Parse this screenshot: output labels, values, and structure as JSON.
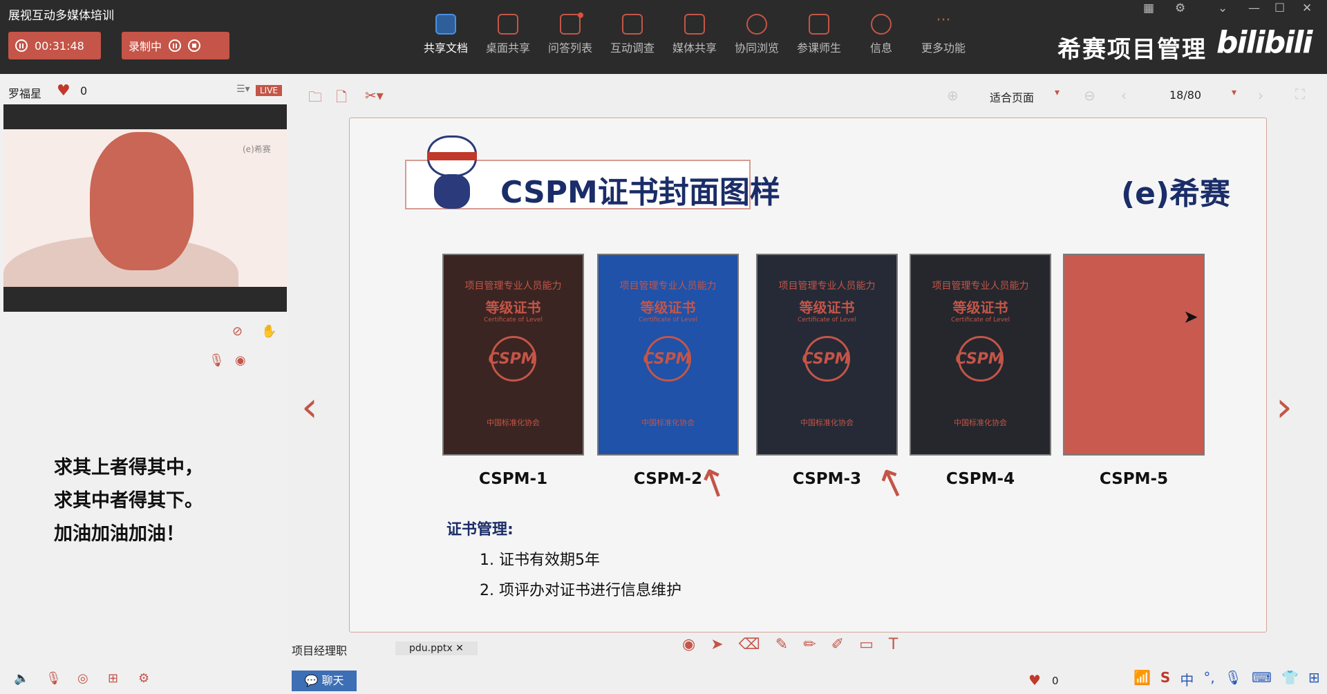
{
  "app": {
    "title": "展视互动多媒体培训"
  },
  "recording": {
    "timer": "00:31:48",
    "status": "录制中"
  },
  "toolbar": [
    {
      "label": "共享文档",
      "icon": "document-icon",
      "active": true
    },
    {
      "label": "桌面共享",
      "icon": "desktop-icon"
    },
    {
      "label": "问答列表",
      "icon": "chat-icon"
    },
    {
      "label": "互动调查",
      "icon": "bar-chart-icon"
    },
    {
      "label": "媒体共享",
      "icon": "film-icon"
    },
    {
      "label": "协同浏览",
      "icon": "compass-icon"
    },
    {
      "label": "参课师生",
      "icon": "users-icon"
    },
    {
      "label": "信息",
      "icon": "info-icon"
    },
    {
      "label": "更多功能",
      "icon": "more-icon"
    }
  ],
  "brand": {
    "text": "希赛项目管理",
    "logo": "bilibili"
  },
  "left": {
    "presenter": "罗福星",
    "likes": "0",
    "live": "LIVE",
    "watermark": "(e)希赛",
    "motto": [
      "求其上者得其中，",
      "求其中者得其下。",
      "加油加油加油！"
    ]
  },
  "viewer": {
    "zoom": "适合页面",
    "page": "18/80"
  },
  "slide": {
    "title": "CSPM证书封面图样",
    "brand": "(e)希赛",
    "certificates": [
      {
        "label": "CSPM-1",
        "color": "#3a2522",
        "org": "项目管理专业人员能力",
        "level": "等级证书",
        "en": "Certificate of Level",
        "logo": "CSPM",
        "foot": "中国标准化协会"
      },
      {
        "label": "CSPM-2",
        "color": "#1f52a8",
        "org": "项目管理专业人员能力",
        "level": "等级证书",
        "en": "Certificate of Level",
        "logo": "CSPM",
        "foot": "中国标准化协会"
      },
      {
        "label": "CSPM-3",
        "color": "#252a36",
        "org": "项目管理专业人员能力",
        "level": "等级证书",
        "en": "Certificate of Level",
        "logo": "CSPM",
        "foot": "中国标准化协会"
      },
      {
        "label": "CSPM-4",
        "color": "#25272d",
        "org": "项目管理专业人员能力",
        "level": "等级证书",
        "en": "Certificate of Level",
        "logo": "CSPM",
        "foot": "中国标准化协会"
      },
      {
        "label": "CSPM-5",
        "color": "#c85a50",
        "org": "",
        "level": "",
        "en": "",
        "logo": "",
        "foot": ""
      }
    ],
    "mgmt_title": "证书管理:",
    "items": [
      "1. 证书有效期5年",
      "2. 项评办对证书进行信息维护"
    ]
  },
  "docs": {
    "current": "项目经理职",
    "file": "pdu.pptx"
  },
  "bottom": {
    "chat": "聊天",
    "likes": "0",
    "ime": "中"
  }
}
